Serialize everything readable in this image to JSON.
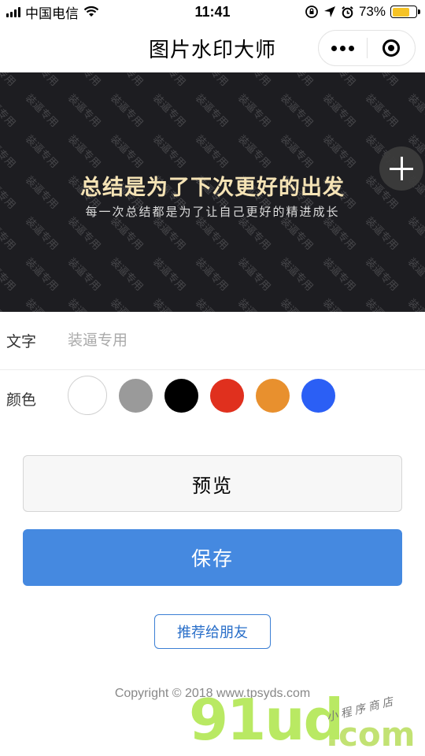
{
  "status_bar": {
    "carrier": "中国电信",
    "time": "11:41",
    "battery_percent": "73%",
    "battery_level": 0.73
  },
  "nav": {
    "title": "图片水印大师",
    "menu_icon": "more-dots-icon",
    "close_icon": "miniprogram-close-icon"
  },
  "preview": {
    "headline": "总结是为了下次更好的出发",
    "subline": "每一次总结都是为了让自己更好的精进成长",
    "watermark_text": "装逼专用",
    "add_icon": "plus-icon"
  },
  "form": {
    "text_label": "文字",
    "text_placeholder": "装逼专用",
    "color_label": "颜色",
    "colors": [
      "#ffffff",
      "#9a9a9a",
      "#000000",
      "#e0301e",
      "#e8902e",
      "#2b5ff5"
    ],
    "selected_color": "#ffffff"
  },
  "buttons": {
    "preview": "预览",
    "save": "保存",
    "share": "推荐给朋友"
  },
  "footer": {
    "copyright": "Copyright © 2018 www.tpsyds.com"
  },
  "overlay_watermark": {
    "logo": "91ud",
    "domain": ".com",
    "tagline": "小程序商店"
  }
}
